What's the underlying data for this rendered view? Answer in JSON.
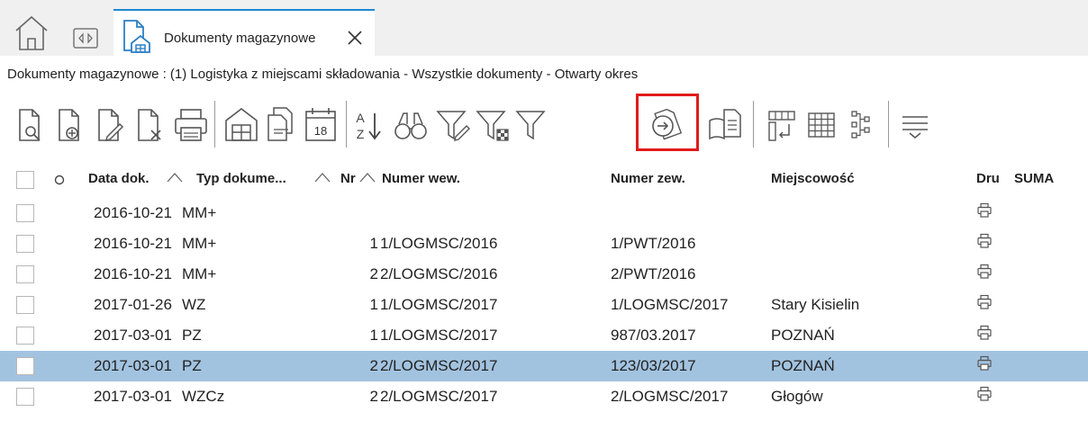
{
  "tab": {
    "title": "Dokumenty magazynowe"
  },
  "breadcrumb": "Dokumenty magazynowe : (1) Logistyka z miejscami składowania - Wszystkie dokumenty - Otwarty okres",
  "toolbar": {
    "calendar_day": "18",
    "sort_letters_top": "A",
    "sort_letters_bottom": "Z",
    "highlighted_button": "bring-documents-button"
  },
  "table": {
    "columns": {
      "date": "Data dok.",
      "type": "Typ dokume...",
      "nr": "Nr",
      "numer_wew": "Numer wew.",
      "numer_zew": "Numer zew.",
      "miejscowosc": "Miejscowość",
      "dru": "Dru",
      "suma": "SUMA"
    },
    "rows": [
      {
        "date": "2016-10-21",
        "type": "MM+",
        "nr": "",
        "numer_wew": "",
        "numer_zew": "",
        "miejscowosc": "",
        "selected": false
      },
      {
        "date": "2016-10-21",
        "type": "MM+",
        "nr": "1",
        "numer_wew": "1/LOGMSC/2016",
        "numer_zew": "1/PWT/2016",
        "miejscowosc": "",
        "selected": false
      },
      {
        "date": "2016-10-21",
        "type": "MM+",
        "nr": "2",
        "numer_wew": "2/LOGMSC/2016",
        "numer_zew": "2/PWT/2016",
        "miejscowosc": "",
        "selected": false
      },
      {
        "date": "2017-01-26",
        "type": "WZ",
        "nr": "1",
        "numer_wew": "1/LOGMSC/2017",
        "numer_zew": "1/LOGMSC/2017",
        "miejscowosc": "Stary Kisielin",
        "selected": false
      },
      {
        "date": "2017-03-01",
        "type": "PZ",
        "nr": "1",
        "numer_wew": "1/LOGMSC/2017",
        "numer_zew": "987/03.2017",
        "miejscowosc": "POZNAŃ",
        "selected": false
      },
      {
        "date": "2017-03-01",
        "type": "PZ",
        "nr": "2",
        "numer_wew": "2/LOGMSC/2017",
        "numer_zew": "123/03/2017",
        "miejscowosc": "POZNAŃ",
        "selected": true
      },
      {
        "date": "2017-03-01",
        "type": "WZCz",
        "nr": "2",
        "numer_wew": "2/LOGMSC/2017",
        "numer_zew": "2/LOGMSC/2017",
        "miejscowosc": "Głogów",
        "selected": false
      }
    ]
  },
  "colors": {
    "accent": "#1e88d0",
    "highlight_border": "#e01b1b",
    "selected_row": "#a2c3e0"
  }
}
